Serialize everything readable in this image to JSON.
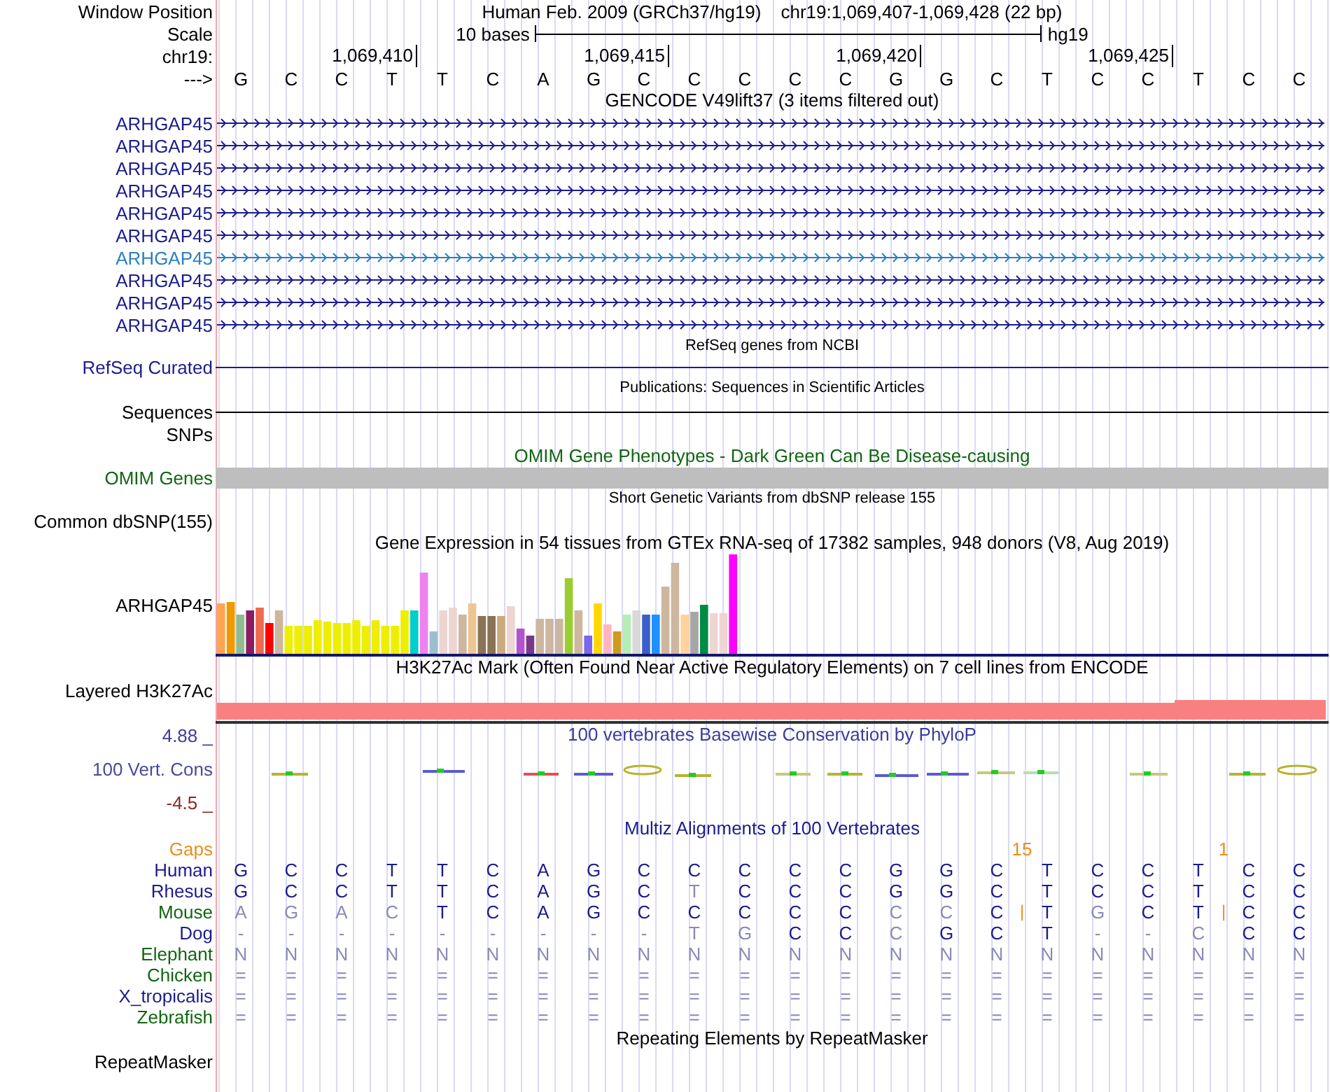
{
  "header": {
    "window_position_label": "Window Position",
    "assembly": "Human Feb. 2009 (GRCh37/hg19)",
    "position": "chr19:1,069,407-1,069,428 (22 bp)",
    "scale_label": "Scale",
    "scale_text": "10 bases",
    "scale_db": "hg19",
    "chrom_label": "chr19:",
    "ticks": [
      "1,069,410",
      "1,069,415",
      "1,069,420",
      "1,069,425"
    ],
    "strand_label": "--->",
    "bases": [
      "G",
      "C",
      "C",
      "T",
      "T",
      "C",
      "A",
      "G",
      "C",
      "C",
      "C",
      "C",
      "C",
      "G",
      "G",
      "C",
      "T",
      "C",
      "C",
      "T",
      "C",
      "C"
    ]
  },
  "gencode": {
    "title": "GENCODE V49lift37 (3 items filtered out)",
    "items": [
      {
        "name": "ARHGAP45",
        "color": "#1c1c8c"
      },
      {
        "name": "ARHGAP45",
        "color": "#1c1c8c"
      },
      {
        "name": "ARHGAP45",
        "color": "#1c1c8c"
      },
      {
        "name": "ARHGAP45",
        "color": "#1c1c8c"
      },
      {
        "name": "ARHGAP45",
        "color": "#1c1c8c"
      },
      {
        "name": "ARHGAP45",
        "color": "#1c1c8c"
      },
      {
        "name": "ARHGAP45",
        "color": "#2a7fbf"
      },
      {
        "name": "ARHGAP45",
        "color": "#1c1c8c"
      },
      {
        "name": "ARHGAP45",
        "color": "#1c1c8c"
      },
      {
        "name": "ARHGAP45",
        "color": "#1c1c8c"
      }
    ]
  },
  "refseq": {
    "title": "RefSeq genes from NCBI",
    "label": "RefSeq Curated"
  },
  "publications": {
    "title": "Publications: Sequences in Scientific Articles",
    "label": "Sequences"
  },
  "snps": {
    "label": "SNPs"
  },
  "omim": {
    "title": "OMIM Gene Phenotypes - Dark Green Can Be Disease-causing",
    "label": "OMIM Genes"
  },
  "dbsnp": {
    "title": "Short Genetic Variants from dbSNP release 155",
    "label": "Common dbSNP(155)"
  },
  "gtex": {
    "title": "Gene Expression in 54 tissues from GTEx RNA-seq of 17382 samples, 948 donors (V8, Aug 2019)",
    "label": "ARHGAP45"
  },
  "h3k27ac": {
    "title": "H3K27Ac Mark (Often Found Near Active Regulatory Elements) on 7 cell lines from ENCODE",
    "label": "Layered H3K27Ac"
  },
  "phylop": {
    "title": "100 vertebrates Basewise Conservation by PhyloP",
    "label": "100 Vert. Cons",
    "max_label": "4.88 _",
    "min_label": "-4.5 _"
  },
  "multiz": {
    "title": "Multiz Alignments of 100 Vertebrates",
    "gaps_label": "Gaps",
    "gap_counts": [
      "15",
      "1"
    ],
    "species": [
      {
        "name": "Human",
        "color": "#1c1c8c",
        "bases": [
          "G",
          "C",
          "C",
          "T",
          "T",
          "C",
          "A",
          "G",
          "C",
          "C",
          "C",
          "C",
          "C",
          "G",
          "G",
          "C",
          "T",
          "C",
          "C",
          "T",
          "C",
          "C"
        ]
      },
      {
        "name": "Rhesus",
        "color": "#1c1c8c",
        "bases": [
          "G",
          "C",
          "C",
          "T",
          "T",
          "C",
          "A",
          "G",
          "C",
          "T",
          "C",
          "C",
          "C",
          "G",
          "G",
          "C",
          "T",
          "C",
          "C",
          "T",
          "C",
          "C"
        ]
      },
      {
        "name": "Mouse",
        "color": "#116611",
        "bases": [
          "A",
          "G",
          "A",
          "C",
          "T",
          "C",
          "A",
          "G",
          "C",
          "C",
          "C",
          "C",
          "C",
          "C",
          "C",
          "C",
          "|",
          "T",
          "G",
          "C",
          "T",
          "|",
          "C",
          "C"
        ]
      },
      {
        "name": "Dog",
        "color": "#1c1c8c",
        "bases": [
          "-",
          "-",
          "-",
          "-",
          "-",
          "-",
          "-",
          "-",
          "-",
          "T",
          "G",
          "C",
          "C",
          "C",
          "G",
          "C",
          "T",
          "-",
          "-",
          "C",
          "C",
          "C"
        ]
      },
      {
        "name": "Elephant",
        "color": "#116611",
        "bases": [
          "N",
          "N",
          "N",
          "N",
          "N",
          "N",
          "N",
          "N",
          "N",
          "N",
          "N",
          "N",
          "N",
          "N",
          "N",
          "N",
          "N",
          "N",
          "N",
          "N",
          "N",
          "N"
        ]
      },
      {
        "name": "Chicken",
        "color": "#116611",
        "bases": [
          "=",
          "=",
          "=",
          "=",
          "=",
          "=",
          "=",
          "=",
          "=",
          "=",
          "=",
          "=",
          "=",
          "=",
          "=",
          "=",
          "=",
          "=",
          "=",
          "=",
          "=",
          "="
        ]
      },
      {
        "name": "X_tropicalis",
        "color": "#1c1c8c",
        "bases": [
          "=",
          "=",
          "=",
          "=",
          "=",
          "=",
          "=",
          "=",
          "=",
          "=",
          "=",
          "=",
          "=",
          "=",
          "=",
          "=",
          "=",
          "=",
          "=",
          "=",
          "=",
          "="
        ]
      },
      {
        "name": "Zebrafish",
        "color": "#116611",
        "bases": [
          "=",
          "=",
          "=",
          "=",
          "=",
          "=",
          "=",
          "=",
          "=",
          "=",
          "=",
          "=",
          "=",
          "=",
          "=",
          "=",
          "=",
          "=",
          "=",
          "=",
          "=",
          "="
        ]
      }
    ]
  },
  "repeatmasker": {
    "title": "Repeating Elements by RepeatMasker",
    "label": "RepeatMasker"
  }
}
